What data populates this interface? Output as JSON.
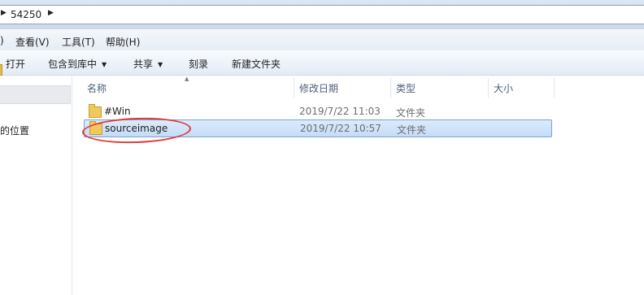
{
  "address_bar": {
    "crumb": "54250"
  },
  "menu": [
    {
      "label": "查看(V)"
    },
    {
      "label": "工具(T)"
    },
    {
      "label": "帮助(H)"
    }
  ],
  "menu_partial": {
    "label": ")"
  },
  "toolbar": {
    "open_label": "打开",
    "library_label": "包含到库中",
    "share_label": "共享",
    "burn_label": "刻录",
    "new_folder_label": "新建文件夹"
  },
  "nav": {
    "places_label": "的位置"
  },
  "columns": {
    "name": "名称",
    "date": "修改日期",
    "type": "类型",
    "size": "大小"
  },
  "files": [
    {
      "name": "#Win",
      "date": "2019/7/22 11:03",
      "type": "文件夹",
      "selected": false
    },
    {
      "name": "sourceimage",
      "date": "2019/7/22 10:57",
      "type": "文件夹",
      "selected": true
    }
  ],
  "colors": {
    "selection_bg": "#cfe2f9",
    "selection_border": "#7da2ce",
    "annotation": "#e03a3a"
  }
}
